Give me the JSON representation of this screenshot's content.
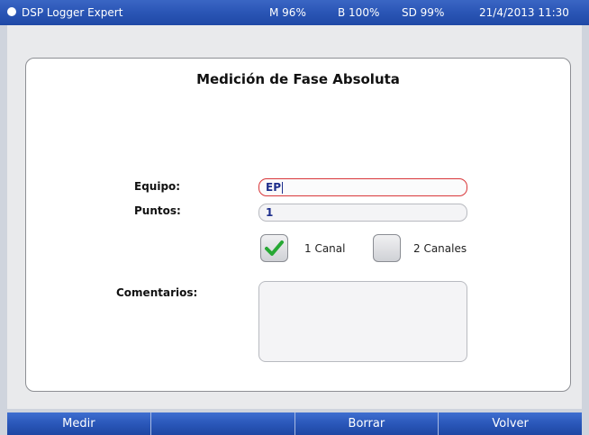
{
  "statusbar": {
    "app_title": "DSP Logger Expert",
    "memory": "M 96%",
    "battery": "B 100%",
    "sd": "SD 99%",
    "datetime": "21/4/2013 11:30"
  },
  "form": {
    "title": "Medición de Fase Absoluta",
    "equipo_label": "Equipo:",
    "equipo_value": "EP",
    "puntos_label": "Puntos:",
    "puntos_value": "1",
    "channel_options": [
      {
        "label": "1 Canal",
        "checked": true
      },
      {
        "label": "2 Canales",
        "checked": false
      }
    ],
    "comentarios_label": "Comentarios:",
    "comentarios_value": ""
  },
  "toolbar": {
    "buttons": [
      "Medir",
      "",
      "Borrar",
      "Volver"
    ]
  },
  "colors": {
    "bar_blue": "#2a55b5",
    "focus_border": "#d9373a",
    "check_green": "#27a834",
    "input_text": "#1e2f8c"
  },
  "icons": {
    "status_dot": "status-dot-icon",
    "checkmark": "checkmark-icon"
  }
}
